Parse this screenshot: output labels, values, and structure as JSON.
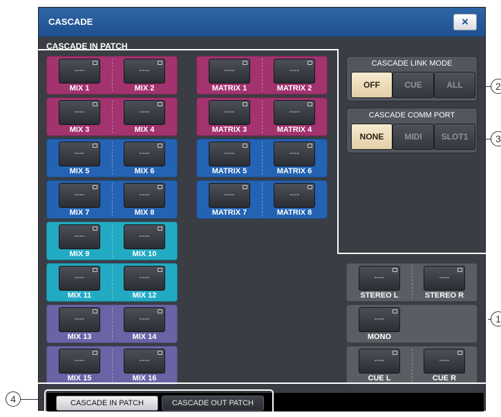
{
  "window": {
    "title": "CASCADE",
    "close_icon": "×"
  },
  "section_title": "CASCADE IN PATCH",
  "patch_value": "----",
  "mix_groups": [
    {
      "color": "#a2336f",
      "labels": [
        "MIX 1",
        "MIX 2"
      ]
    },
    {
      "color": "#a2336f",
      "labels": [
        "MIX 3",
        "MIX 4"
      ]
    },
    {
      "color": "#2463b3",
      "labels": [
        "MIX 5",
        "MIX 6"
      ]
    },
    {
      "color": "#2463b3",
      "labels": [
        "MIX 7",
        "MIX 8"
      ]
    },
    {
      "color": "#23aac3",
      "labels": [
        "MIX 9",
        "MIX 10"
      ]
    },
    {
      "color": "#23aac3",
      "labels": [
        "MIX 11",
        "MIX 12"
      ]
    },
    {
      "color": "#6a63a5",
      "labels": [
        "MIX 13",
        "MIX 14"
      ]
    },
    {
      "color": "#6a63a5",
      "labels": [
        "MIX 15",
        "MIX 16"
      ]
    }
  ],
  "matrix_groups": [
    {
      "color": "#a2336f",
      "labels": [
        "MATRIX 1",
        "MATRIX 2"
      ]
    },
    {
      "color": "#a2336f",
      "labels": [
        "MATRIX 3",
        "MATRIX 4"
      ]
    },
    {
      "color": "#2463b3",
      "labels": [
        "MATRIX 5",
        "MATRIX 6"
      ]
    },
    {
      "color": "#2463b3",
      "labels": [
        "MATRIX 7",
        "MATRIX 8"
      ]
    }
  ],
  "stereo_group": {
    "color": "#5a5d63",
    "labels": [
      "STEREO L",
      "STEREO R"
    ]
  },
  "mono_group": {
    "color": "#5a5d63",
    "labels": [
      "MONO"
    ]
  },
  "cue_group": {
    "color": "#5a5d63",
    "labels": [
      "CUE L",
      "CUE R"
    ]
  },
  "link_mode": {
    "title": "CASCADE LINK MODE",
    "options": [
      "OFF",
      "CUE",
      "ALL"
    ],
    "selected": "OFF"
  },
  "comm_port": {
    "title": "CASCADE COMM PORT",
    "options": [
      "NONE",
      "MIDI",
      "SLOT1"
    ],
    "selected": "NONE"
  },
  "tabs": [
    "CASCADE IN PATCH",
    "CASCADE OUT PATCH"
  ],
  "active_tab": "CASCADE IN PATCH",
  "callouts": [
    "2",
    "3",
    "1",
    "4"
  ]
}
